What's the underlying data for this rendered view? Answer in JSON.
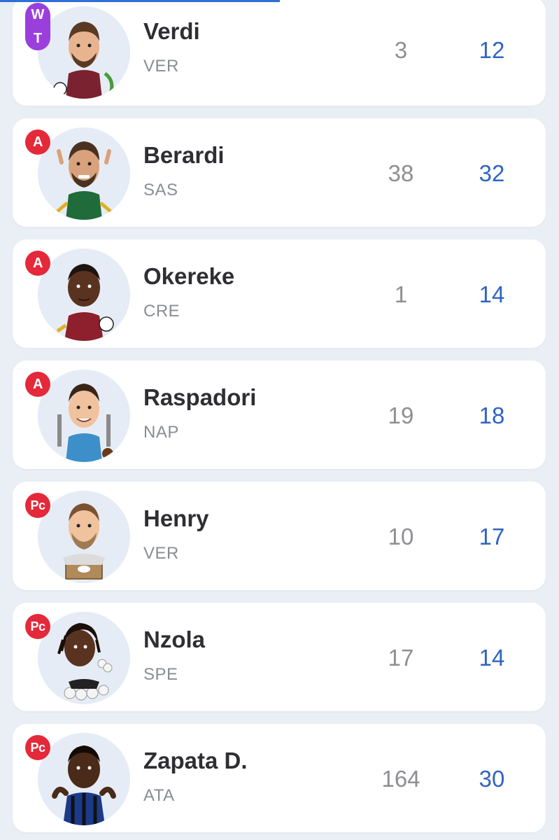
{
  "colors": {
    "background": "#eaeef5",
    "card": "#ffffff",
    "badge_role": "#e4293a",
    "badge_wt": "#9b3fdc",
    "value_blue": "#2f64c4",
    "value_grey": "#8e8e93"
  },
  "players": [
    {
      "role": "W T",
      "role_top": "W",
      "role_bottom": "T",
      "name": "Verdi",
      "team": "VER",
      "stat1": "3",
      "stat2": "12",
      "avatar_icon": "player-avatar-icon"
    },
    {
      "role": "A",
      "name": "Berardi",
      "team": "SAS",
      "stat1": "38",
      "stat2": "32",
      "avatar_icon": "player-avatar-icon"
    },
    {
      "role": "A",
      "name": "Okereke",
      "team": "CRE",
      "stat1": "1",
      "stat2": "14",
      "avatar_icon": "player-avatar-icon"
    },
    {
      "role": "A",
      "name": "Raspadori",
      "team": "NAP",
      "stat1": "19",
      "stat2": "18",
      "avatar_icon": "player-avatar-icon"
    },
    {
      "role": "Pc",
      "name": "Henry",
      "team": "VER",
      "stat1": "10",
      "stat2": "17",
      "avatar_icon": "player-avatar-icon"
    },
    {
      "role": "Pc",
      "name": "Nzola",
      "team": "SPE",
      "stat1": "17",
      "stat2": "14",
      "avatar_icon": "player-avatar-icon"
    },
    {
      "role": "Pc",
      "name": "Zapata D.",
      "team": "ATA",
      "stat1": "164",
      "stat2": "30",
      "avatar_icon": "player-avatar-icon"
    }
  ]
}
